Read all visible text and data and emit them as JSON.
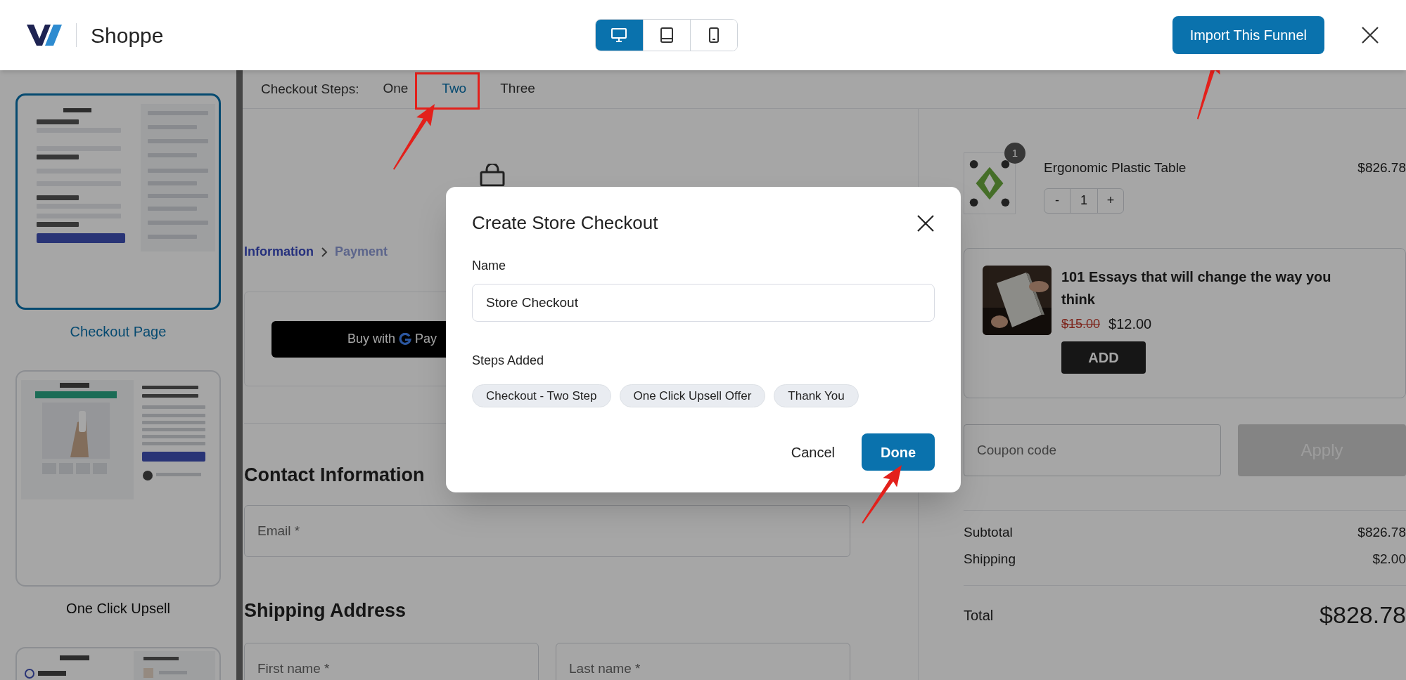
{
  "header": {
    "brand": "Shoppe",
    "devices": [
      {
        "kind": "desktop",
        "selected": true
      },
      {
        "kind": "tablet",
        "selected": false
      },
      {
        "kind": "mobile",
        "selected": false
      }
    ],
    "import_button": "Import This Funnel"
  },
  "sidebar": {
    "steps": [
      {
        "kind": "checkout",
        "label": "Checkout Page",
        "selected": true
      },
      {
        "kind": "upsell",
        "label": "One Click Upsell",
        "selected": false
      },
      {
        "kind": "thankyou",
        "selected": false
      }
    ]
  },
  "checkout_steps": {
    "label": "Checkout Steps:",
    "tabs": [
      {
        "label": "One",
        "selected": false
      },
      {
        "label": "Two",
        "selected": true
      },
      {
        "label": "Three",
        "selected": false
      }
    ]
  },
  "preview": {
    "breadcrumb": [
      {
        "label": "Information",
        "selected": true
      },
      {
        "label": "Payment",
        "selected": false
      }
    ],
    "express_button": {
      "label": "Buy with",
      "brand": "Pay"
    },
    "contact_heading": "Contact Information",
    "email_placeholder": "Email *",
    "shipping_heading": "Shipping Address",
    "first_name_placeholder": "First name *",
    "last_name_placeholder": "Last name *"
  },
  "order": {
    "item": {
      "name": "Ergonomic Plastic Table",
      "price": "$826.78",
      "badge": "1",
      "minus": "-",
      "quantity": "1",
      "plus": "+"
    },
    "upsell": {
      "title": "101 Essays that will change the way you think",
      "old_price": "$15.00",
      "price": "$12.00",
      "button": "ADD"
    },
    "coupon_placeholder": "Coupon code",
    "apply": {
      "label": "Apply",
      "disabled": true
    },
    "lines": [
      {
        "label": "Subtotal",
        "value": "$826.78"
      },
      {
        "label": "Shipping",
        "value": "$2.00"
      }
    ],
    "total": {
      "label": "Total",
      "value": "$828.78"
    }
  },
  "modal": {
    "title": "Create Store Checkout",
    "name_label": "Name",
    "name_value": "Store Checkout",
    "steps_label": "Steps Added",
    "steps": [
      "Checkout - Two Step",
      "One Click Upsell Offer",
      "Thank You"
    ],
    "cancel": "Cancel",
    "done": "Done"
  }
}
